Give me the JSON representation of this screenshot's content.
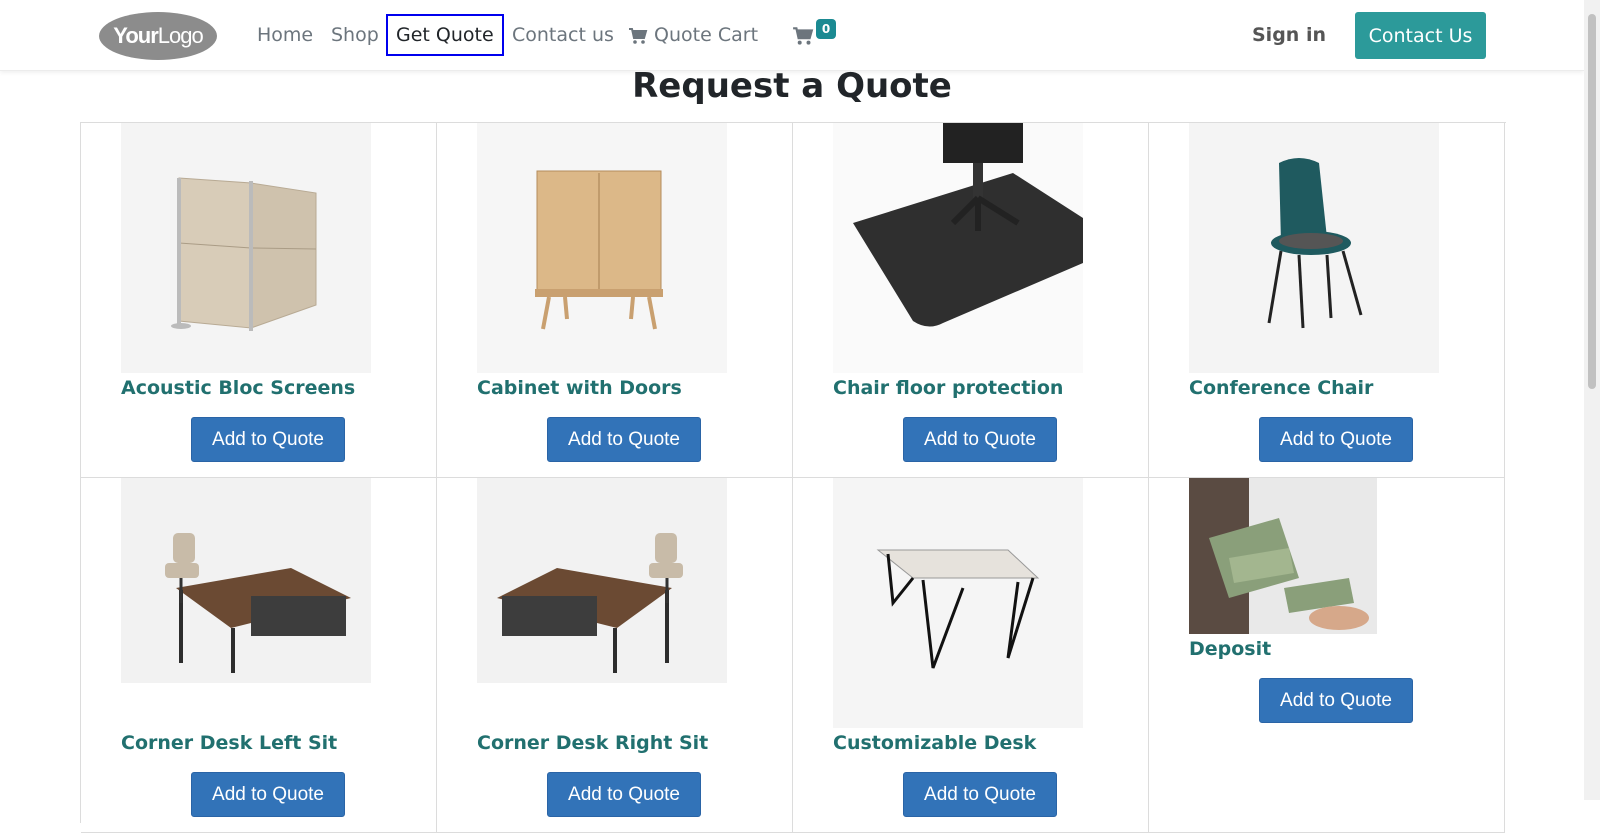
{
  "header": {
    "logo_text_bold": "Your",
    "logo_text_thin": "Logo",
    "nav": [
      "Home",
      "Shop",
      "Get Quote",
      "Contact us",
      "Quote Cart"
    ],
    "active_nav": "Get Quote",
    "cart_count": "0",
    "signin": "Sign in",
    "contact_button": "Contact Us"
  },
  "page": {
    "title": "Request a Quote"
  },
  "products": [
    {
      "name": "Acoustic Bloc Screens",
      "button": "Add to Quote"
    },
    {
      "name": "Cabinet with Doors",
      "button": "Add to Quote"
    },
    {
      "name": "Chair floor protection",
      "button": "Add to Quote"
    },
    {
      "name": "Conference Chair",
      "button": "Add to Quote"
    },
    {
      "name": "Corner Desk Left Sit",
      "button": "Add to Quote"
    },
    {
      "name": "Corner Desk Right Sit",
      "button": "Add to Quote"
    },
    {
      "name": "Customizable Desk",
      "button": "Add to Quote"
    },
    {
      "name": "Deposit",
      "button": "Add to Quote"
    }
  ],
  "colors": {
    "brand_teal": "#2c9a9a",
    "button_blue": "#3273b8",
    "product_name": "#21706f"
  }
}
